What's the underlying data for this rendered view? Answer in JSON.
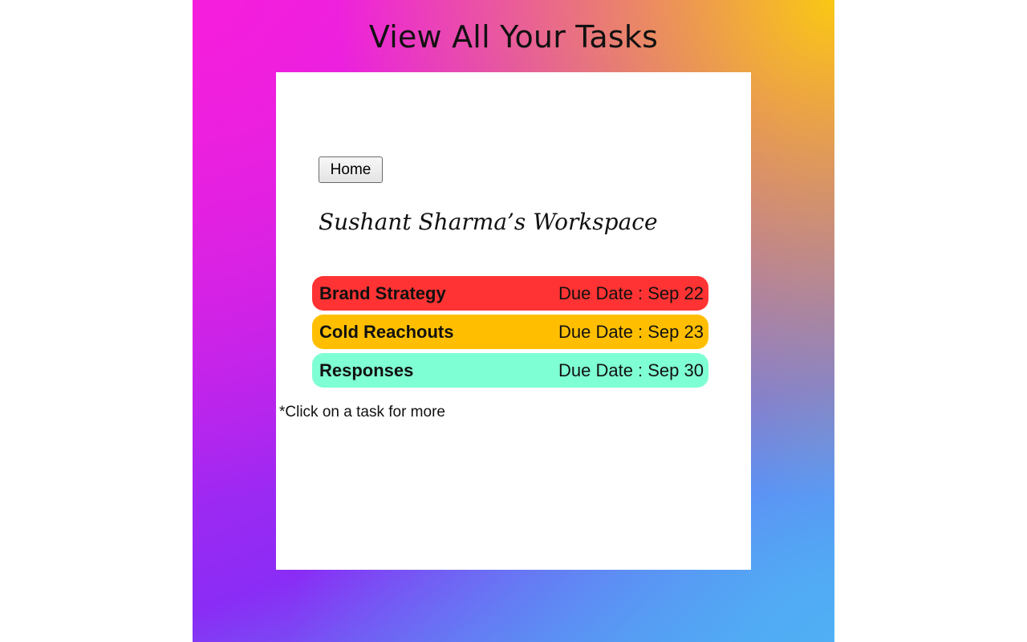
{
  "promo": {
    "title": "View All Your Tasks"
  },
  "app": {
    "home_button_label": "Home",
    "workspace_title": "Sushant Sharma’s Workspace",
    "hint_text": "*Click on a task for more"
  },
  "tasks": [
    {
      "name": "Brand Strategy",
      "due": "Due Date : Sep 22",
      "color": "#ff3333"
    },
    {
      "name": "Cold Reachouts",
      "due": "Due Date : Sep 23",
      "color": "#ffbf00"
    },
    {
      "name": "Responses",
      "due": "Due Date : Sep 30",
      "color": "#7fffd4"
    }
  ]
}
